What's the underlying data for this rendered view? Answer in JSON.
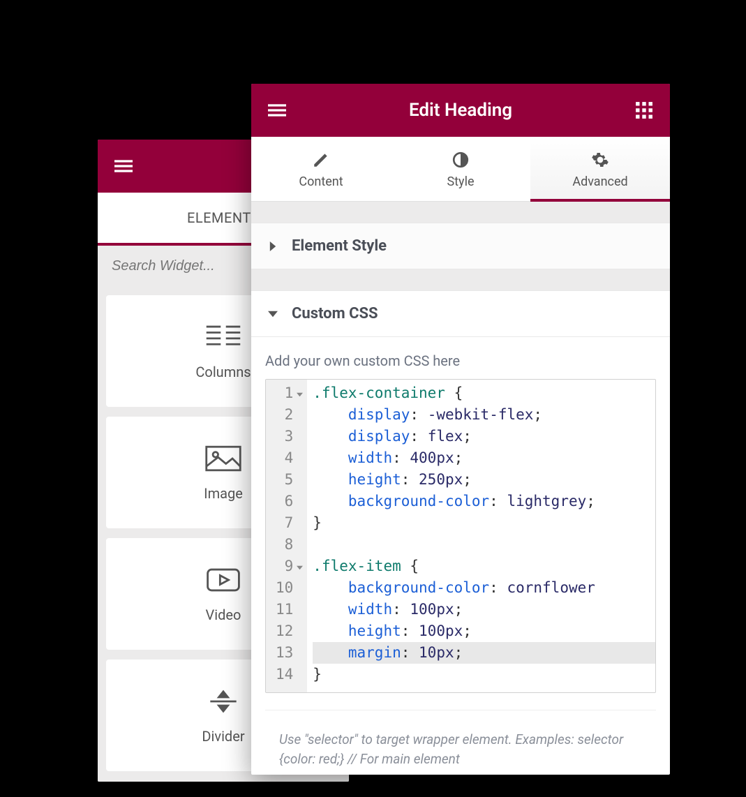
{
  "back_panel": {
    "tab": "ELEMENTS",
    "search_placeholder": "Search Widget...",
    "widgets": [
      {
        "label": "Columns",
        "icon": "columns"
      },
      {
        "label": "Image",
        "icon": "image"
      },
      {
        "label": "Video",
        "icon": "video"
      },
      {
        "label": "Divider",
        "icon": "divider"
      }
    ]
  },
  "front_panel": {
    "title": "Edit Heading",
    "tabs": [
      {
        "label": "Content",
        "icon": "pencil",
        "active": false
      },
      {
        "label": "Style",
        "icon": "contrast",
        "active": false
      },
      {
        "label": "Advanced",
        "icon": "gear",
        "active": true
      }
    ],
    "sections": {
      "element_style": {
        "label": "Element Style",
        "open": false
      },
      "custom_css": {
        "label": "Custom CSS",
        "open": true
      }
    },
    "custom_css": {
      "hint": "Add your own custom CSS here",
      "note": "Use \"selector\" to target wrapper element. Examples: selector {color: red;} // For main element",
      "lines": [
        {
          "n": 1,
          "fold": true,
          "tokens": [
            [
              ".flex-container",
              "sel"
            ],
            [
              " {",
              "punc"
            ]
          ]
        },
        {
          "n": 2,
          "tokens": [
            [
              "    ",
              null
            ],
            [
              "display",
              "prop"
            ],
            [
              ": ",
              "punc"
            ],
            [
              "-webkit-flex",
              "val"
            ],
            [
              ";",
              "punc"
            ]
          ]
        },
        {
          "n": 3,
          "tokens": [
            [
              "    ",
              null
            ],
            [
              "display",
              "prop"
            ],
            [
              ": ",
              "punc"
            ],
            [
              "flex",
              "val"
            ],
            [
              ";",
              "punc"
            ]
          ]
        },
        {
          "n": 4,
          "tokens": [
            [
              "    ",
              null
            ],
            [
              "width",
              "prop"
            ],
            [
              ": ",
              "punc"
            ],
            [
              "400px",
              "num"
            ],
            [
              ";",
              "punc"
            ]
          ]
        },
        {
          "n": 5,
          "tokens": [
            [
              "    ",
              null
            ],
            [
              "height",
              "prop"
            ],
            [
              ": ",
              "punc"
            ],
            [
              "250px",
              "num"
            ],
            [
              ";",
              "punc"
            ]
          ]
        },
        {
          "n": 6,
          "tokens": [
            [
              "    ",
              null
            ],
            [
              "background-color",
              "prop"
            ],
            [
              ": ",
              "punc"
            ],
            [
              "lightgrey",
              "val"
            ],
            [
              ";",
              "punc"
            ]
          ]
        },
        {
          "n": 7,
          "tokens": [
            [
              "}",
              "punc"
            ]
          ]
        },
        {
          "n": 8,
          "tokens": [
            [
              "",
              null
            ]
          ]
        },
        {
          "n": 9,
          "fold": true,
          "tokens": [
            [
              ".flex-item",
              "sel"
            ],
            [
              " {",
              "punc"
            ]
          ]
        },
        {
          "n": 10,
          "tokens": [
            [
              "    ",
              null
            ],
            [
              "background-color",
              "prop"
            ],
            [
              ": ",
              "punc"
            ],
            [
              "cornflower",
              "val"
            ]
          ]
        },
        {
          "n": 11,
          "tokens": [
            [
              "    ",
              null
            ],
            [
              "width",
              "prop"
            ],
            [
              ": ",
              "punc"
            ],
            [
              "100px",
              "num"
            ],
            [
              ";",
              "punc"
            ]
          ]
        },
        {
          "n": 12,
          "tokens": [
            [
              "    ",
              null
            ],
            [
              "height",
              "prop"
            ],
            [
              ": ",
              "punc"
            ],
            [
              "100px",
              "num"
            ],
            [
              ";",
              "punc"
            ]
          ]
        },
        {
          "n": 13,
          "hl": true,
          "tokens": [
            [
              "    ",
              null
            ],
            [
              "margin",
              "prop"
            ],
            [
              ": ",
              "punc"
            ],
            [
              "10px",
              "num"
            ],
            [
              ";",
              "punc"
            ]
          ]
        },
        {
          "n": 14,
          "tokens": [
            [
              "}",
              "punc"
            ]
          ]
        }
      ]
    }
  }
}
